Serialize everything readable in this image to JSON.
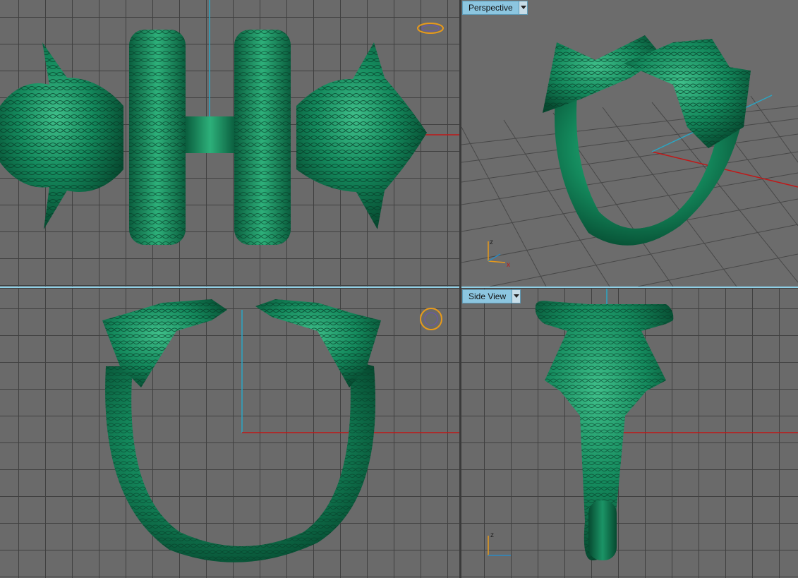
{
  "viewports": {
    "top": {
      "label": ""
    },
    "perspective": {
      "label": "Perspective"
    },
    "front": {
      "label": ""
    },
    "side": {
      "label": "Side View"
    }
  },
  "axes": {
    "x": "x",
    "z": "z"
  },
  "colors": {
    "model": "#17835c",
    "grid": "#404040",
    "background": "#6a6a6a",
    "active_border": "#8ecfe6",
    "axis_x": "#c01818",
    "axis_y": "#2aa6c4"
  }
}
